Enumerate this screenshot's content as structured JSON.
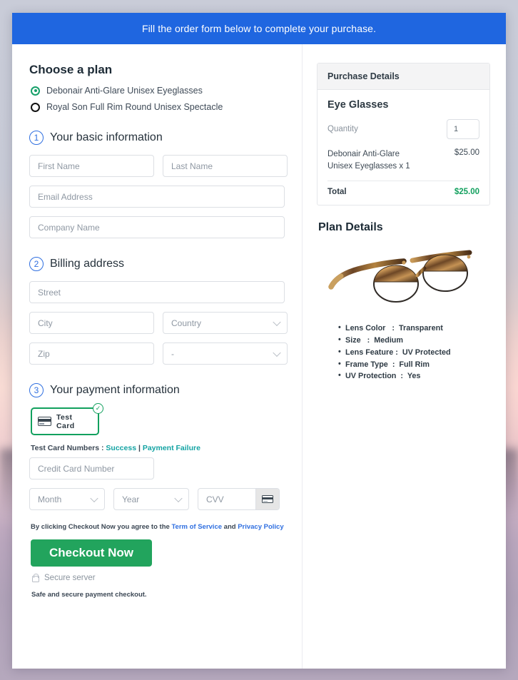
{
  "banner": {
    "text": "Fill the order form below to complete your purchase."
  },
  "plan": {
    "heading": "Choose a plan",
    "options": [
      {
        "label": "Debonair Anti-Glare Unisex Eyeglasses",
        "selected": true
      },
      {
        "label": "Royal Son Full Rim Round Unisex Spectacle",
        "selected": false
      }
    ]
  },
  "steps": {
    "basic": {
      "number": "1",
      "title": "Your basic information"
    },
    "billing": {
      "number": "2",
      "title": "Billing address"
    },
    "payment": {
      "number": "3",
      "title": "Your payment information"
    }
  },
  "fields": {
    "first_name": "First Name",
    "last_name": "Last Name",
    "email": "Email Address",
    "company": "Company Name",
    "street": "Street",
    "city": "City",
    "country": "Country",
    "zip": "Zip",
    "state": "-",
    "credit_card": "Credit Card Number",
    "month": "Month",
    "year": "Year",
    "cvv": "CVV"
  },
  "payment": {
    "test_card_label": "Test Card",
    "test_numbers_prefix": "Test Card Numbers : ",
    "success_link": "Success",
    "separator": " | ",
    "failure_link": "Payment Failure",
    "agree_prefix": "By clicking Checkout Now you agree to the ",
    "terms_link": "Term of Service",
    "agree_and": " and ",
    "privacy_link": "Privacy Policy",
    "checkout_label": "Checkout Now",
    "secure_server": "Secure server",
    "safe_note": "Safe and secure payment checkout."
  },
  "purchase": {
    "panel_title": "Purchase Details",
    "product_group": "Eye Glasses",
    "quantity_label": "Quantity",
    "quantity_value": "1",
    "line_item": "Debonair Anti-Glare Unisex Eyeglasses x 1",
    "line_price": "$25.00",
    "total_label": "Total",
    "total_value": "$25.00"
  },
  "plan_details": {
    "heading": "Plan Details",
    "specs": [
      {
        "key": "Lens Color",
        "sep": ":",
        "value": "Transparent"
      },
      {
        "key": "Size",
        "sep": ":",
        "value": "Medium"
      },
      {
        "key": "Lens Feature",
        "sep": ":",
        "value": "UV Protected"
      },
      {
        "key": "Frame Type",
        "sep": ":",
        "value": "Full Rim"
      },
      {
        "key": "UV Protection",
        "sep": ":",
        "value": "Yes"
      }
    ]
  },
  "colors": {
    "banner_blue": "#1f66e0",
    "accent_green": "#22a45d",
    "check_green": "#12a05e",
    "link_teal": "#13a3a3",
    "link_blue": "#2f6fe0",
    "total_green": "#12a05e"
  }
}
